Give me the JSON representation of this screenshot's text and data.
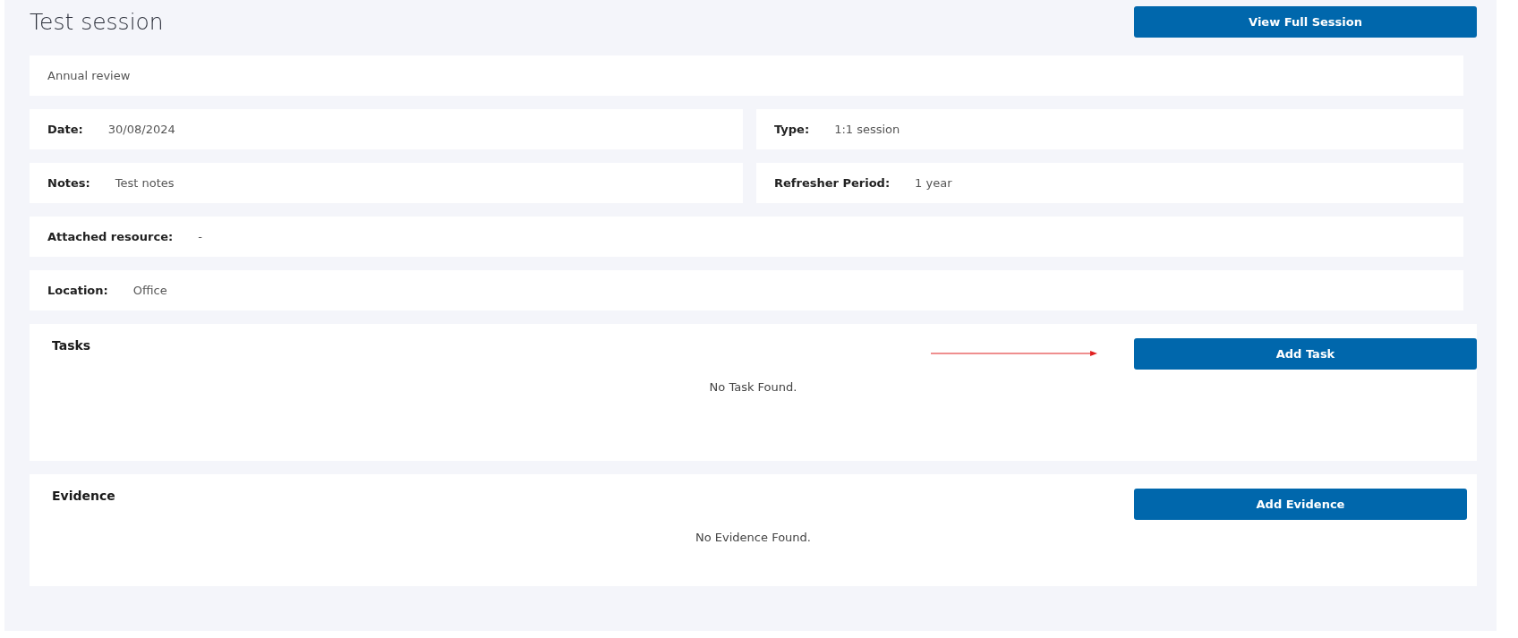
{
  "title": "Test session",
  "view_button": "View Full Session",
  "summary": "Annual review",
  "field_rows": [
    [
      {
        "label": "Date:",
        "value": "30/08/2024"
      },
      {
        "label": "Type:",
        "value": "1:1 session"
      }
    ],
    [
      {
        "label": "Notes:",
        "value": "Test notes"
      },
      {
        "label": "Refresher Period:",
        "value": "1 year"
      }
    ],
    [
      {
        "label": "Attached resource:",
        "value": "-"
      }
    ],
    [
      {
        "label": "Location:",
        "value": "Office"
      }
    ]
  ],
  "sections": [
    {
      "title": "Tasks",
      "button": "Add Task",
      "empty_message": "No Task Found.",
      "pointer_arrow": true
    },
    {
      "title": "Evidence",
      "button": "Add Evidence",
      "empty_message": "No Evidence Found.",
      "pointer_arrow": false
    }
  ]
}
